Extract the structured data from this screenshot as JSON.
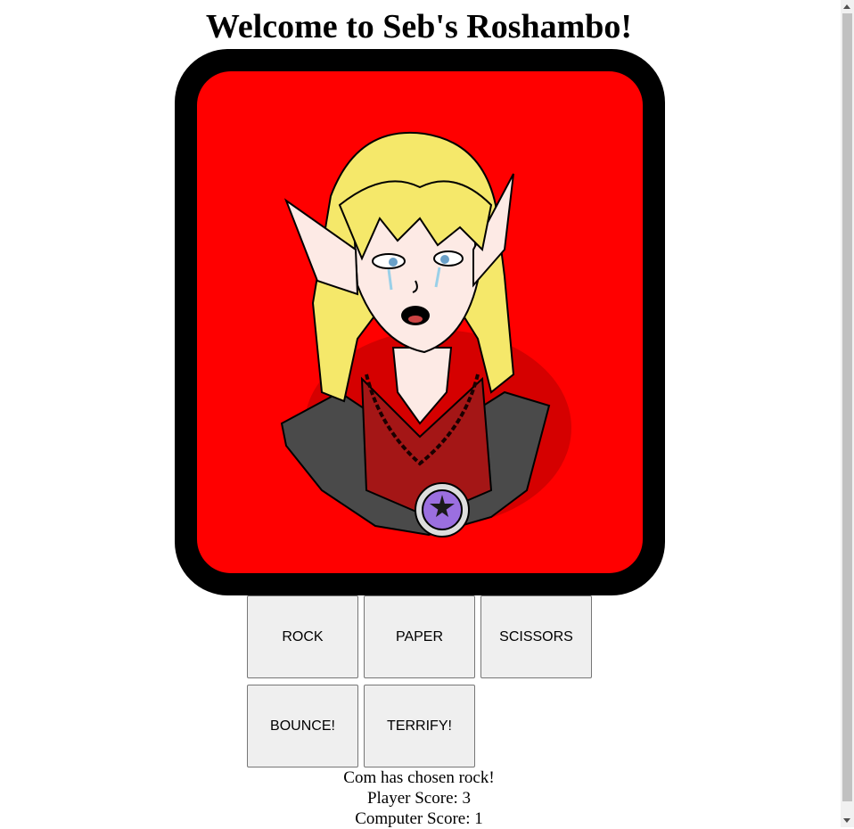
{
  "header": {
    "title": "Welcome to Seb's Roshambo!"
  },
  "character": {
    "icon": "crying-elf-portrait"
  },
  "buttons": {
    "rock": "ROCK",
    "paper": "PAPER",
    "scissors": "SCISSORS",
    "bounce": "BOUNCE!",
    "terrify": "TERRIFY!"
  },
  "status": {
    "message": "Com has chosen rock!",
    "player_score": "Player Score: 3",
    "computer_score": "Computer Score: 1"
  },
  "colors": {
    "frame": "#000000",
    "background": "#ff0000",
    "hair": "#f5e86a",
    "robe": "#a41616",
    "gem": "#9b6fe0"
  }
}
